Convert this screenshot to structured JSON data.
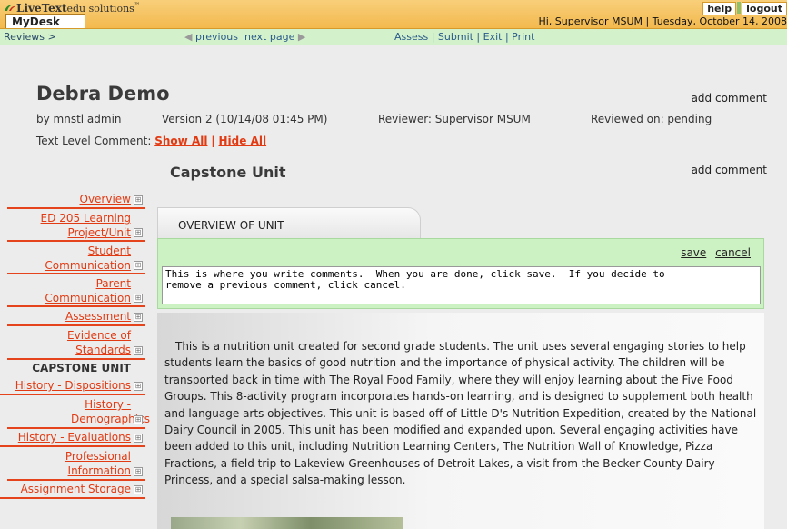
{
  "header": {
    "logo_main": "LiveText",
    "logo_sub": "edu solutions",
    "logo_tm": "™",
    "tab": "MyDesk",
    "help": "help",
    "logout": "logout",
    "greeting": "Hi, Supervisor MSUM  |  Tuesday, October 14, 2008"
  },
  "navbar": {
    "reviews": "Reviews >",
    "prev": "previous",
    "next": "next page",
    "actions": "Assess | Submit | Exit | Print"
  },
  "document": {
    "title": "Debra Demo",
    "add_comment": "add comment",
    "author": "by mnstl admin",
    "version": "Version 2 (10/14/08 01:45 PM)",
    "reviewer": "Reviewer: Supervisor MSUM",
    "reviewed_on": "Reviewed on: pending",
    "text_level_label": "Text Level Comment:",
    "show_all": "Show All",
    "divider": "|",
    "hide_all": "Hide All"
  },
  "unit": {
    "title": "Capstone Unit",
    "add_comment": "add comment",
    "tab_label": "OVERVIEW OF UNIT"
  },
  "sidebar": {
    "items": [
      {
        "label": "Overview"
      },
      {
        "label": "ED 205 Learning Project/Unit"
      },
      {
        "label": "Student Communication"
      },
      {
        "label": "Parent Communication"
      },
      {
        "label": "Assessment"
      },
      {
        "label": "Evidence of Standards"
      },
      {
        "label": "CAPSTONE UNIT"
      },
      {
        "label": "History - Dispositions"
      },
      {
        "label": "History - Demographics"
      },
      {
        "label": "History - Evaluations"
      },
      {
        "label": "Professional Information"
      },
      {
        "label": "Assignment Storage"
      }
    ]
  },
  "comment": {
    "save": "save",
    "cancel": "cancel",
    "text": "This is where you write comments.  When you are done, click save.  If you decide to\nremove a previous comment, click cancel."
  },
  "body": {
    "paragraph": "This is a nutrition unit created for second grade students. The unit uses several engaging stories to help students learn the basics of good nutrition and the importance of physical activity. The children will be transported back in time with The Royal Food Family, where they will enjoy learning about the Five Food Groups. This 8-activity program incorporates hands-on learning, and is designed to supplement both health and language arts objectives. This unit is based off of  Little D's Nutrition Expedition,  created by the National Dairy Council in 2005. This unit has been modified and expanded upon. Several engaging activities have been added to this unit, including Nutrition Learning Centers, The Nutrition Wall of Knowledge, Pizza Fractions, a field trip to Lakeview Greenhouses of Detroit Lakes, a visit from the Becker County Dairy Princess, and a special salsa-making lesson."
  },
  "colors": {
    "topbar": "#f3b94e",
    "navbar": "#d3f2cc",
    "link_red": "#e23a12",
    "comment_green": "#ccf1c3"
  }
}
